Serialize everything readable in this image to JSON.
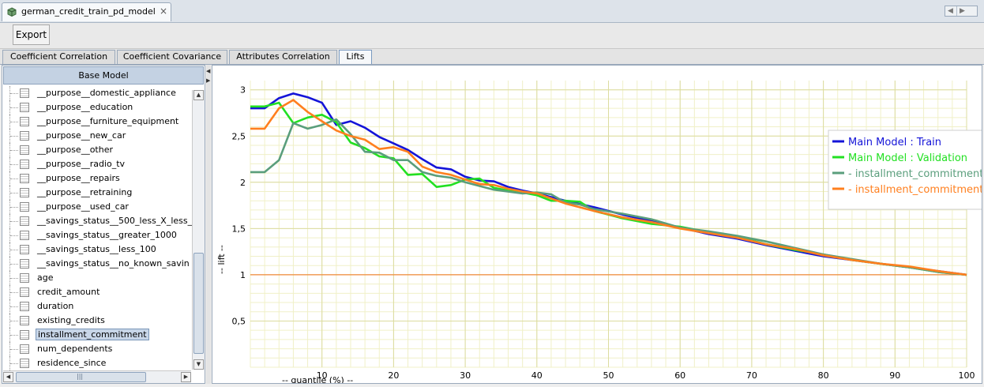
{
  "window": {
    "title": "german_credit_train_pd_model",
    "close_glyph": "×",
    "nav_left": "◀",
    "nav_right": "▶"
  },
  "toolbar": {
    "export_label": "Export"
  },
  "tabs": [
    {
      "label": "Coefficient Correlation"
    },
    {
      "label": "Coefficient Covariance"
    },
    {
      "label": "Attributes Correlation"
    },
    {
      "label": "Lifts",
      "active": true
    }
  ],
  "sidebar": {
    "header": "Base Model",
    "items": [
      {
        "label": "__purpose__domestic_appliance"
      },
      {
        "label": "__purpose__education"
      },
      {
        "label": "__purpose__furniture_equipment"
      },
      {
        "label": "__purpose__new_car"
      },
      {
        "label": "__purpose__other"
      },
      {
        "label": "__purpose__radio_tv"
      },
      {
        "label": "__purpose__repairs"
      },
      {
        "label": "__purpose__retraining"
      },
      {
        "label": "__purpose__used_car"
      },
      {
        "label": "__savings_status__500_less_X_less_"
      },
      {
        "label": "__savings_status__greater_1000"
      },
      {
        "label": "__savings_status__less_100"
      },
      {
        "label": "__savings_status__no_known_savin"
      },
      {
        "label": "age"
      },
      {
        "label": "credit_amount"
      },
      {
        "label": "duration"
      },
      {
        "label": "existing_credits"
      },
      {
        "label": "installment_commitment",
        "selected": true
      },
      {
        "label": "num_dependents"
      },
      {
        "label": "residence_since"
      }
    ],
    "scroll_up": "▲",
    "scroll_down": "▼",
    "scroll_left": "◀",
    "scroll_right": "▶",
    "thumb_grip": "|||",
    "splitter_left": "◀",
    "splitter_right": "▶"
  },
  "colors": {
    "train": "#1414d8",
    "validation": "#22e022",
    "var_a": "#5a9e7c",
    "var_b": "#ff7f1e",
    "baseline": "#f08a3c",
    "grid": "#f0f0c8"
  },
  "chart_data": {
    "type": "line",
    "xlabel": "-- quantile (%) --",
    "ylabel": "-- lift --",
    "xlim": [
      0,
      100
    ],
    "ylim": [
      0,
      3.1
    ],
    "xticks": [
      10,
      20,
      30,
      40,
      50,
      60,
      70,
      80,
      90,
      100
    ],
    "yticks": [
      {
        "v": 0.5,
        "label": "0,5"
      },
      {
        "v": 1,
        "label": "1"
      },
      {
        "v": 1.5,
        "label": "1,5"
      },
      {
        "v": 2,
        "label": "2"
      },
      {
        "v": 2.5,
        "label": "2,5"
      },
      {
        "v": 3,
        "label": "3"
      }
    ],
    "grid": true,
    "legend_position": "top-right",
    "baseline": 1,
    "series": [
      {
        "name": "Main Model : Train",
        "color_key": "train",
        "x": [
          0,
          2,
          4,
          6,
          8,
          10,
          12,
          14,
          16,
          18,
          20,
          22,
          24,
          26,
          28,
          30,
          32,
          34,
          36,
          38,
          40,
          44,
          48,
          52,
          56,
          60,
          64,
          68,
          72,
          76,
          80,
          84,
          88,
          92,
          96,
          100
        ],
        "y": [
          2.8,
          2.8,
          2.91,
          2.96,
          2.92,
          2.86,
          2.62,
          2.66,
          2.59,
          2.49,
          2.42,
          2.35,
          2.25,
          2.16,
          2.14,
          2.06,
          2.02,
          2.01,
          1.95,
          1.91,
          1.88,
          1.8,
          1.73,
          1.65,
          1.58,
          1.51,
          1.44,
          1.39,
          1.32,
          1.26,
          1.2,
          1.16,
          1.12,
          1.08,
          1.04,
          1.0
        ]
      },
      {
        "name": "Main Model : Validation",
        "color_key": "validation",
        "x": [
          0,
          2,
          4,
          6,
          8,
          10,
          12,
          14,
          16,
          18,
          20,
          22,
          24,
          26,
          28,
          30,
          32,
          34,
          36,
          38,
          40,
          42,
          44,
          46,
          48,
          52,
          56,
          60,
          64,
          68,
          72,
          76,
          80,
          84,
          88,
          92,
          96,
          100
        ],
        "y": [
          2.82,
          2.82,
          2.86,
          2.64,
          2.7,
          2.73,
          2.65,
          2.43,
          2.37,
          2.28,
          2.26,
          2.08,
          2.09,
          1.95,
          1.97,
          2.03,
          2.04,
          1.94,
          1.91,
          1.89,
          1.86,
          1.8,
          1.8,
          1.79,
          1.69,
          1.61,
          1.55,
          1.52,
          1.46,
          1.41,
          1.33,
          1.27,
          1.22,
          1.16,
          1.12,
          1.08,
          1.03,
          1.0
        ]
      },
      {
        "name": "- installment_commitment",
        "color_key": "var_a",
        "x": [
          0,
          2,
          4,
          6,
          8,
          10,
          12,
          14,
          16,
          18,
          20,
          22,
          24,
          26,
          28,
          30,
          34,
          38,
          40,
          42,
          44,
          46,
          48,
          52,
          56,
          60,
          64,
          68,
          72,
          76,
          80,
          84,
          88,
          92,
          96,
          100
        ],
        "y": [
          2.11,
          2.11,
          2.24,
          2.64,
          2.58,
          2.62,
          2.68,
          2.52,
          2.33,
          2.32,
          2.24,
          2.24,
          2.11,
          2.07,
          2.05,
          2.0,
          1.92,
          1.88,
          1.89,
          1.87,
          1.78,
          1.76,
          1.71,
          1.66,
          1.6,
          1.51,
          1.47,
          1.42,
          1.36,
          1.29,
          1.22,
          1.17,
          1.12,
          1.08,
          1.03,
          1.0
        ]
      },
      {
        "name": "- installment_commitment",
        "color_key": "var_b",
        "x": [
          0,
          2,
          4,
          6,
          8,
          10,
          12,
          14,
          16,
          18,
          20,
          22,
          24,
          26,
          28,
          30,
          32,
          34,
          36,
          38,
          40,
          44,
          48,
          52,
          56,
          60,
          64,
          68,
          72,
          76,
          80,
          84,
          88,
          92,
          96,
          100
        ],
        "y": [
          2.58,
          2.58,
          2.8,
          2.89,
          2.76,
          2.66,
          2.56,
          2.5,
          2.46,
          2.36,
          2.38,
          2.33,
          2.17,
          2.11,
          2.08,
          2.03,
          1.98,
          1.97,
          1.93,
          1.9,
          1.88,
          1.77,
          1.69,
          1.62,
          1.57,
          1.5,
          1.45,
          1.4,
          1.33,
          1.28,
          1.21,
          1.16,
          1.12,
          1.09,
          1.04,
          1.0
        ]
      }
    ]
  }
}
